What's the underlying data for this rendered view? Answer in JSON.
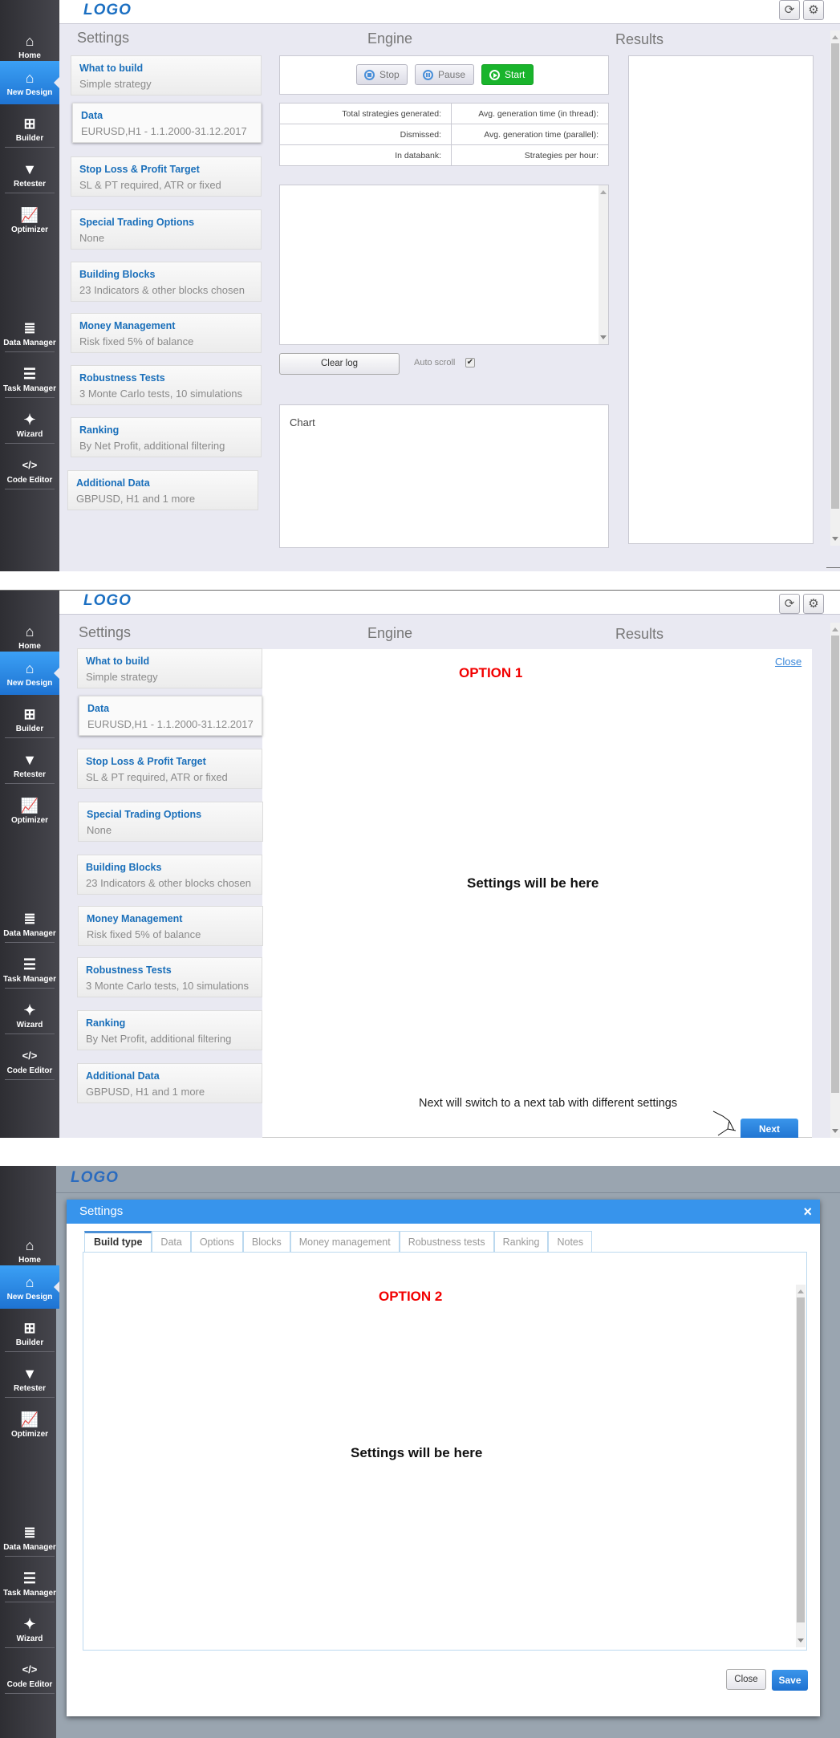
{
  "nav": [
    {
      "label": "Home",
      "icon": "home-icon"
    },
    {
      "label": "New Design",
      "icon": "home-icon",
      "active": true
    },
    {
      "label": "Builder",
      "icon": "plus-square-icon"
    },
    {
      "label": "Retester",
      "icon": "filter-icon"
    },
    {
      "label": "Optimizer",
      "icon": "chart-line-icon"
    },
    {
      "label": "Data Manager",
      "icon": "database-icon"
    },
    {
      "label": "Task Manager",
      "icon": "server-icon"
    },
    {
      "label": "Wizard",
      "icon": "magic-wand-icon"
    },
    {
      "label": "Code Editor",
      "icon": "code-icon"
    }
  ],
  "logo": "LOGO",
  "columns": {
    "settings": "Settings",
    "engine": "Engine",
    "results": "Results"
  },
  "settings_cards": [
    {
      "title": "What to build",
      "value": "Simple strategy"
    },
    {
      "title": "Data",
      "value": "EURUSD,H1 - 1.1.2000-31.12.2017"
    },
    {
      "title": "Stop Loss & Profit Target",
      "value": "SL & PT required, ATR or fixed"
    },
    {
      "title": "Special Trading Options",
      "value": "None"
    },
    {
      "title": "Building Blocks",
      "value": "23 Indicators & other blocks chosen"
    },
    {
      "title": "Money Management",
      "value": "Risk fixed 5% of balance"
    },
    {
      "title": "Robustness Tests",
      "value": "3 Monte Carlo tests, 10 simulations"
    },
    {
      "title": "Ranking",
      "value": "By Net Profit, additional filtering"
    },
    {
      "title": "Additional Data",
      "value": "GBPUSD, H1 and 1 more"
    }
  ],
  "engine": {
    "stop": "Stop",
    "pause": "Pause",
    "start": "Start",
    "stats": [
      [
        "Total strategies generated:",
        "Avg. generation time (in thread):"
      ],
      [
        "Dismissed:",
        "Avg. generation time (parallel):"
      ],
      [
        "In databank:",
        "Strategies per hour:"
      ]
    ],
    "clear_log": "Clear log",
    "auto_scroll": "Auto scroll",
    "auto_scroll_checked": true,
    "chart_label": "Chart"
  },
  "option1": {
    "title": "OPTION 1",
    "close": "Close",
    "placeholder": "Settings will be here",
    "note": "Next will switch to a next tab with different settings",
    "next": "Next"
  },
  "option2": {
    "modal_title": "Settings",
    "close_x": "×",
    "title": "OPTION 2",
    "placeholder": "Settings will be here",
    "tabs": [
      "Build type",
      "Data",
      "Options",
      "Blocks",
      "Money management",
      "Robustness tests",
      "Ranking",
      "Notes"
    ],
    "active_tab": "Build type",
    "close": "Close",
    "save": "Save"
  },
  "colors": {
    "accent": "#1e73d2",
    "start": "#19b42c",
    "option_red": "#f20000",
    "link": "#1a6fba"
  }
}
